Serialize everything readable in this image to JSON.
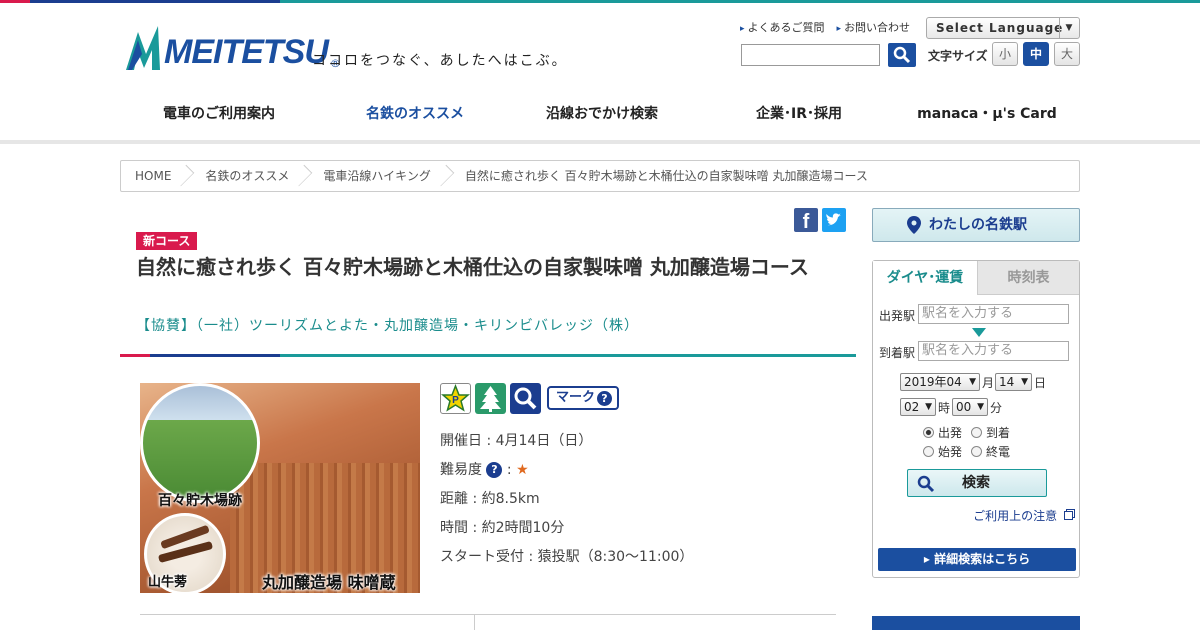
{
  "brand": {
    "logo_text": "MEITETSU",
    "tagline": "ココロをつなぐ、あしたへはこぶ。"
  },
  "header": {
    "links": [
      "よくあるご質問",
      "お問い合わせ"
    ],
    "language_label": "Select Language",
    "font_size_label": "文字サイズ",
    "font_sizes": [
      "小",
      "中",
      "大"
    ],
    "font_size_active": "中"
  },
  "nav": {
    "items": [
      "電車のご利用案内",
      "名鉄のオススメ",
      "沿線おでかけ検索",
      "企業･IR･採用",
      "manaca・μ's Card"
    ],
    "active": "名鉄のオススメ"
  },
  "breadcrumb": [
    "HOME",
    "名鉄のオススメ",
    "電車沿線ハイキング",
    "自然に癒され歩く 百々貯木場跡と木桶仕込の自家製味噌 丸加醸造場コース"
  ],
  "article": {
    "badge": "新コース",
    "title": "自然に癒され歩く 百々貯木場跡と木桶仕込の自家製味噌 丸加醸造場コース",
    "sponsor": "【協賛】（一社）ツーリズムとよた・丸加醸造場・キリンビバレッジ（株）",
    "image_labels": [
      "百々貯木場跡",
      "山牛蒡",
      "丸加醸造場 味噌蔵"
    ],
    "mark_label": "マーク",
    "date": "開催日 : 4月14日（日）",
    "difficulty_label": "難易度",
    "difficulty_stars": 1,
    "distance": "距離 : 約8.5km",
    "duration": "時間 : 約2時間10分",
    "start": "スタート受付 : 猿投駅（8:30～11:00）"
  },
  "sidebar": {
    "my_station": "わたしの名鉄駅",
    "tabs": [
      "ダイヤ･運賃",
      "時刻表"
    ],
    "from_label": "出発駅",
    "to_label": "到着駅",
    "station_placeholder": "駅名を入力する",
    "year_month": "2019年04",
    "month_unit": "月",
    "day": "14",
    "day_unit": "日",
    "hour": "02",
    "hour_unit": "時",
    "minute": "00",
    "minute_unit": "分",
    "radio_options": [
      "出発",
      "到着",
      "始発",
      "終電"
    ],
    "radio_selected": "出発",
    "search_label": "検索",
    "notice_label": "ご利用上の注意",
    "detail_label": "詳細検索はこちら"
  },
  "colors": {
    "brand_blue": "#1b4fa0",
    "teal": "#1a9a9a",
    "accent_red": "#d91a4d"
  }
}
